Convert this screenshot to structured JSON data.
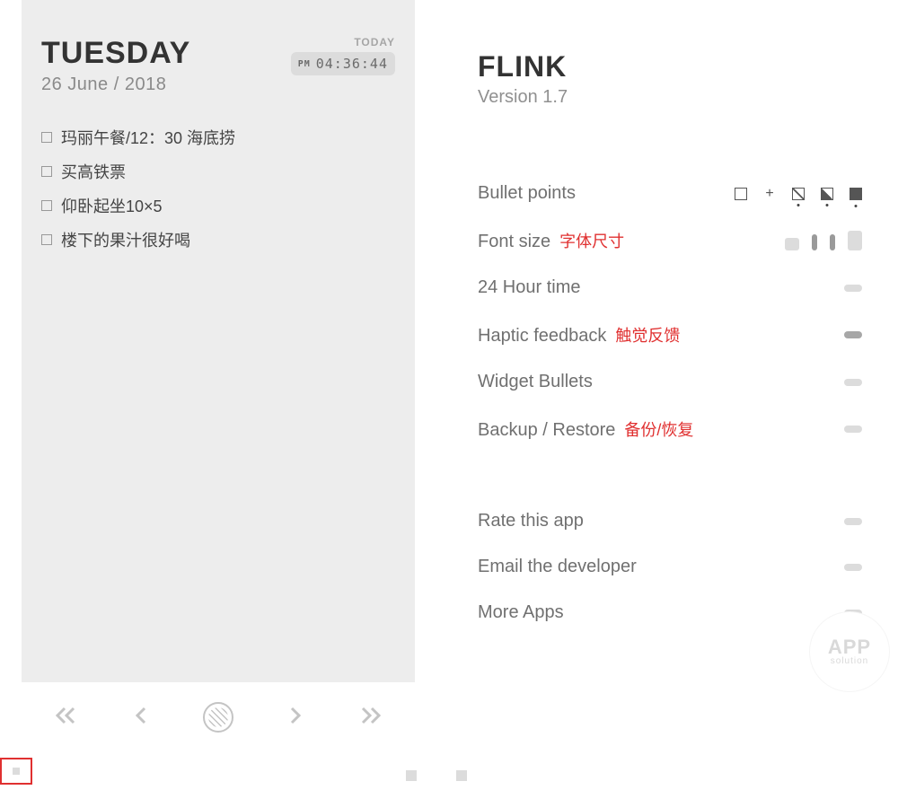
{
  "left": {
    "day": "TUESDAY",
    "date": "26 June / 2018",
    "today_label": "TODAY",
    "time_ampm": "PM",
    "time_value": "04:36:44",
    "todos": [
      "玛丽午餐/12：30 海底捞",
      "买高铁票",
      "仰卧起坐10×5",
      "楼下的果汁很好喝"
    ]
  },
  "right": {
    "title": "FLINK",
    "version": "Version 1.7",
    "settings": {
      "bullet_points_label": "Bullet points",
      "font_size_label": "Font size",
      "font_size_annotation": "字体尺寸",
      "hour24_label": "24 Hour time",
      "haptic_label": "Haptic feedback",
      "haptic_annotation": "触觉反馈",
      "widget_bullets_label": "Widget Bullets",
      "backup_label": "Backup / Restore",
      "backup_annotation": "备份/恢复"
    },
    "more": {
      "rate_label": "Rate this app",
      "email_label": "Email the developer",
      "more_apps_label": "More Apps"
    },
    "logo": {
      "main": "APP",
      "sub": "solution"
    }
  }
}
